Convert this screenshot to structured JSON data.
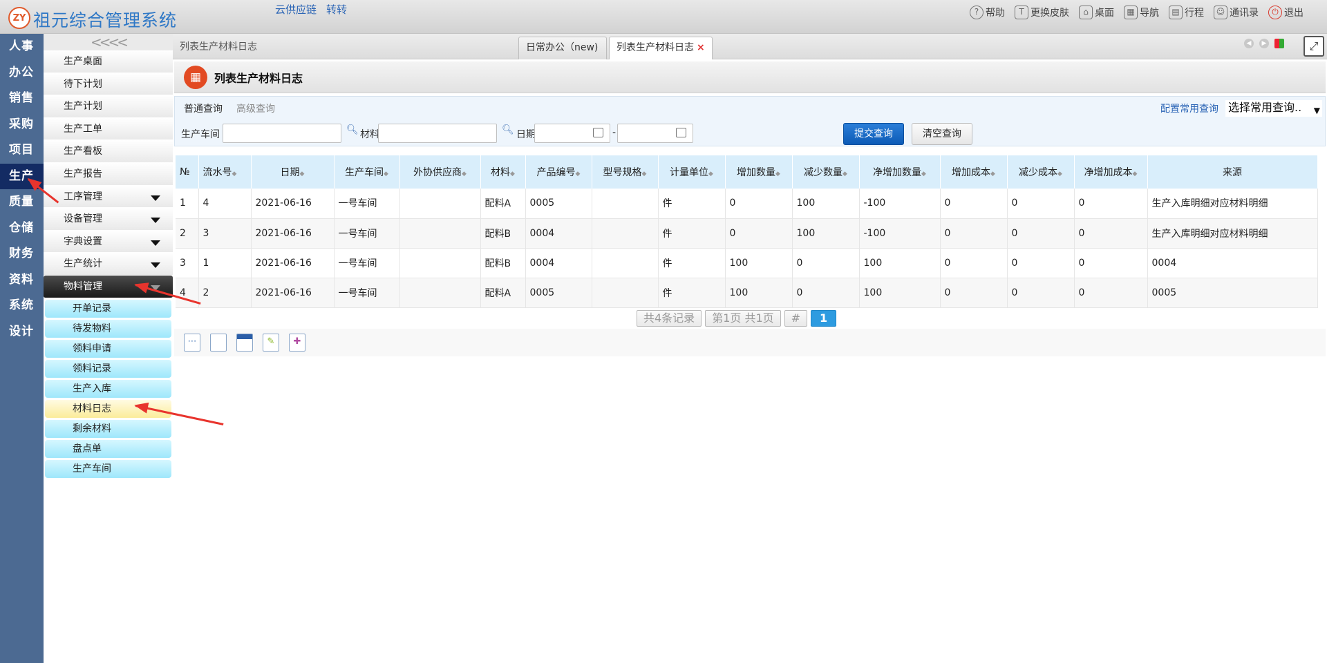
{
  "app": {
    "logo_text": "ZY",
    "title": "祖元综合管理系统"
  },
  "top_links": [
    "云供应链",
    "转转"
  ],
  "top_right": [
    {
      "icon": "help-icon",
      "glyph": "?",
      "label": "帮助"
    },
    {
      "icon": "shirt-icon",
      "glyph": "T",
      "label": "更换皮肤"
    },
    {
      "icon": "home-icon",
      "glyph": "⌂",
      "label": "桌面"
    },
    {
      "icon": "nav-grid-icon",
      "glyph": "▦",
      "label": "导航"
    },
    {
      "icon": "calendar-icon",
      "glyph": "▤",
      "label": "行程"
    },
    {
      "icon": "contacts-icon",
      "glyph": "☺",
      "label": "通讯录"
    },
    {
      "icon": "power-icon",
      "glyph": "⏻",
      "label": "退出"
    }
  ],
  "left_nav": [
    "人事",
    "办公",
    "销售",
    "采购",
    "项目",
    "生产",
    "质量",
    "仓储",
    "财务",
    "资料",
    "系统",
    "设计"
  ],
  "left_nav_active": "生产",
  "submenu": {
    "collapse_glyph": "<<<<",
    "items": [
      {
        "label": "生产桌面",
        "caret": false
      },
      {
        "label": "待下计划",
        "caret": false
      },
      {
        "label": "生产计划",
        "caret": false
      },
      {
        "label": "生产工单",
        "caret": false
      },
      {
        "label": "生产看板",
        "caret": false
      },
      {
        "label": "生产报告",
        "caret": false
      },
      {
        "label": "工序管理",
        "caret": true
      },
      {
        "label": "设备管理",
        "caret": true
      },
      {
        "label": "字典设置",
        "caret": true
      },
      {
        "label": "生产统计",
        "caret": true
      }
    ],
    "expanded": {
      "label": "物料管理",
      "children": [
        "开单记录",
        "待发物料",
        "领料申请",
        "领料记录",
        "生产入库",
        "材料日志",
        "剩余材料",
        "盘点单",
        "生产车间"
      ],
      "active_child": "材料日志"
    }
  },
  "tabs": {
    "breadcrumb": "列表生产材料日志",
    "items": [
      {
        "label": "日常办公（new)",
        "active": false
      },
      {
        "label": "列表生产材料日志",
        "active": true,
        "close": "×"
      }
    ],
    "max_glyph": "⤢"
  },
  "page_title": {
    "icon_glyph": "▦",
    "text": "列表生产材料日志"
  },
  "query": {
    "tabs": [
      "普通查询",
      "高级查询"
    ],
    "config_link": "配置常用查询",
    "common_select": "选择常用查询..",
    "workshop_label": "生产车间",
    "material_label": "材料",
    "date_label": "日期",
    "date_separator": "-",
    "submit": "提交查询",
    "clear": "清空查询"
  },
  "table": {
    "columns": [
      "№",
      "流水号",
      "日期",
      "生产车间",
      "外协供应商",
      "材料",
      "产品编号",
      "型号规格",
      "计量单位",
      "增加数量",
      "减少数量",
      "净增加数量",
      "增加成本",
      "减少成本",
      "净增加成本",
      "来源"
    ],
    "rows": [
      [
        "1",
        "4",
        "2021-06-16",
        "一号车间",
        "",
        "配料A",
        "0005",
        "",
        "件",
        "0",
        "100",
        "-100",
        "0",
        "0",
        "0",
        "生产入库明细对应材料明细"
      ],
      [
        "2",
        "3",
        "2021-06-16",
        "一号车间",
        "",
        "配料B",
        "0004",
        "",
        "件",
        "0",
        "100",
        "-100",
        "0",
        "0",
        "0",
        "生产入库明细对应材料明细"
      ],
      [
        "3",
        "1",
        "2021-06-16",
        "一号车间",
        "",
        "配料B",
        "0004",
        "",
        "件",
        "100",
        "0",
        "100",
        "0",
        "0",
        "0",
        "0004"
      ],
      [
        "4",
        "2",
        "2021-06-16",
        "一号车间",
        "",
        "配料A",
        "0005",
        "",
        "件",
        "100",
        "0",
        "100",
        "0",
        "0",
        "0",
        "0005"
      ]
    ]
  },
  "pager": {
    "total": "共4条记录",
    "page_info": "第1页 共1页",
    "hash": "#",
    "current": "1"
  },
  "toolbar_icons": [
    "select-all-icon",
    "new-doc-icon",
    "calendar-grid-icon",
    "edit-pen-icon",
    "plugin-icon"
  ],
  "colors": {
    "nav_bg": "#4c6a92",
    "nav_active": "#132b63",
    "primary_button": "#0d5bb6",
    "annotation_arrow": "#e8342d"
  }
}
